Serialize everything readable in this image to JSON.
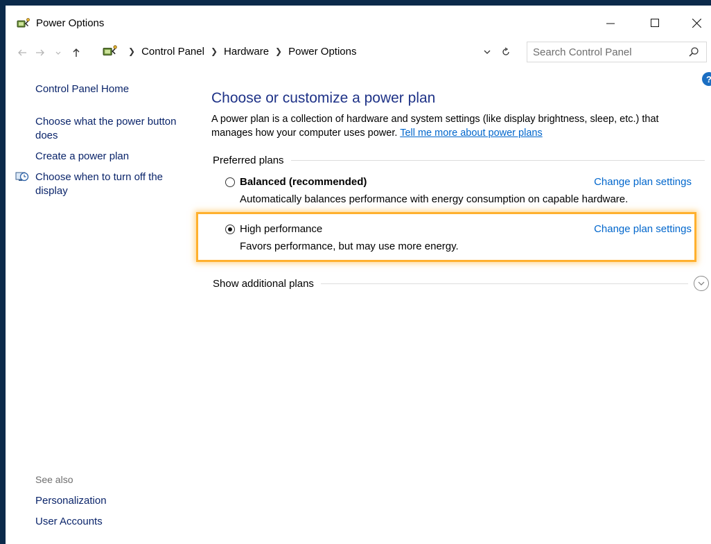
{
  "window": {
    "title": "Power Options"
  },
  "address": {
    "breadcrumb": [
      "Control Panel",
      "Hardware",
      "Power Options"
    ],
    "search_placeholder": "Search Control Panel"
  },
  "sidebar": {
    "items": [
      {
        "label": "Control Panel Home"
      },
      {
        "label": "Choose what the power button does"
      },
      {
        "label": "Create a power plan"
      },
      {
        "label": "Choose when to turn off the display"
      }
    ],
    "see_also_label": "See also",
    "see_also_items": [
      {
        "label": "Personalization"
      },
      {
        "label": "User Accounts"
      }
    ]
  },
  "main": {
    "title": "Choose or customize a power plan",
    "intro_text": "A power plan is a collection of hardware and system settings (like display brightness, sleep, etc.) that manages how your computer uses power.",
    "intro_link": "Tell me more about power plans",
    "preferred_header": "Preferred plans",
    "plans": [
      {
        "name": "Balanced (recommended)",
        "description": "Automatically balances performance with energy consumption on capable hardware.",
        "link": "Change plan settings",
        "selected": false
      },
      {
        "name": "High performance",
        "description": "Favors performance, but may use more energy.",
        "link": "Change plan settings",
        "selected": true
      }
    ],
    "additional_label": "Show additional plans"
  },
  "colors": {
    "title_blue": "#1e3287",
    "link_blue": "#0066cc",
    "highlight": "#ffb02e"
  }
}
